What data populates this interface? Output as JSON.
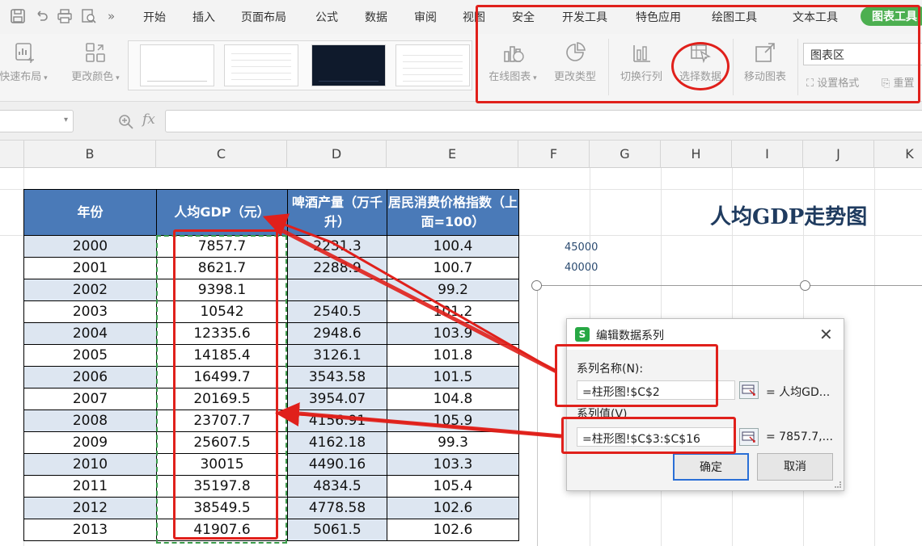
{
  "menu": {
    "tabs": [
      "开始",
      "插入",
      "页面布局",
      "公式",
      "数据",
      "审阅",
      "视图",
      "安全",
      "开发工具",
      "特色应用",
      "绘图工具",
      "文本工具",
      "图表工具"
    ],
    "more": "»"
  },
  "ribbon": {
    "quick_layout": "快速布局",
    "change_color": "更改颜色",
    "online_chart": "在线图表",
    "change_type": "更改类型",
    "switch_row_col": "切换行列",
    "select_data": "选择数据",
    "move_chart": "移动图表",
    "chart_area": "图表区",
    "set_format": "设置格式",
    "reset": "重置"
  },
  "formula_bar": {
    "fx": "fx",
    "value": ""
  },
  "columns": [
    "B",
    "C",
    "D",
    "E",
    "F",
    "G",
    "H",
    "I",
    "J",
    "K"
  ],
  "table": {
    "headers": [
      "年份",
      "人均GDP（元）",
      "啤酒产量（万千升）",
      "居民消费价格指数（上面=100）"
    ],
    "rows": [
      [
        "2000",
        "7857.7",
        "2231.3",
        "100.4"
      ],
      [
        "2001",
        "8621.7",
        "2288.9",
        "100.7"
      ],
      [
        "2002",
        "9398.1",
        "",
        "99.2"
      ],
      [
        "2003",
        "10542",
        "2540.5",
        "101.2"
      ],
      [
        "2004",
        "12335.6",
        "2948.6",
        "103.9"
      ],
      [
        "2005",
        "14185.4",
        "3126.1",
        "101.8"
      ],
      [
        "2006",
        "16499.7",
        "3543.58",
        "101.5"
      ],
      [
        "2007",
        "20169.5",
        "3954.07",
        "104.8"
      ],
      [
        "2008",
        "23707.7",
        "4156.91",
        "105.9"
      ],
      [
        "2009",
        "25607.5",
        "4162.18",
        "99.3"
      ],
      [
        "2010",
        "30015",
        "4490.16",
        "103.3"
      ],
      [
        "2011",
        "35197.8",
        "4834.5",
        "105.4"
      ],
      [
        "2012",
        "38549.5",
        "4778.58",
        "102.6"
      ],
      [
        "2013",
        "41907.6",
        "5061.5",
        "102.6"
      ]
    ]
  },
  "chart": {
    "title": "人均GDP走势图",
    "ticks": [
      "45000",
      "40000"
    ]
  },
  "dialog": {
    "logo": "S",
    "title": "编辑数据系列",
    "close": "✕",
    "series_name_label": "系列名称(N):",
    "series_name_value": "=柱形图!$C$2",
    "series_name_preview": "= 人均GD...",
    "series_values_label": "系列值(V)",
    "series_values_value": "=柱形图!$C$3:$C$16",
    "series_values_preview": "= 7857.7,...",
    "ok": "确定",
    "cancel": "取消"
  },
  "colors": {
    "header_blue": "#4a7ab8",
    "row_shade": "#dde6f1",
    "annotation_red": "#e0201b",
    "accent_green": "#4caf50"
  }
}
